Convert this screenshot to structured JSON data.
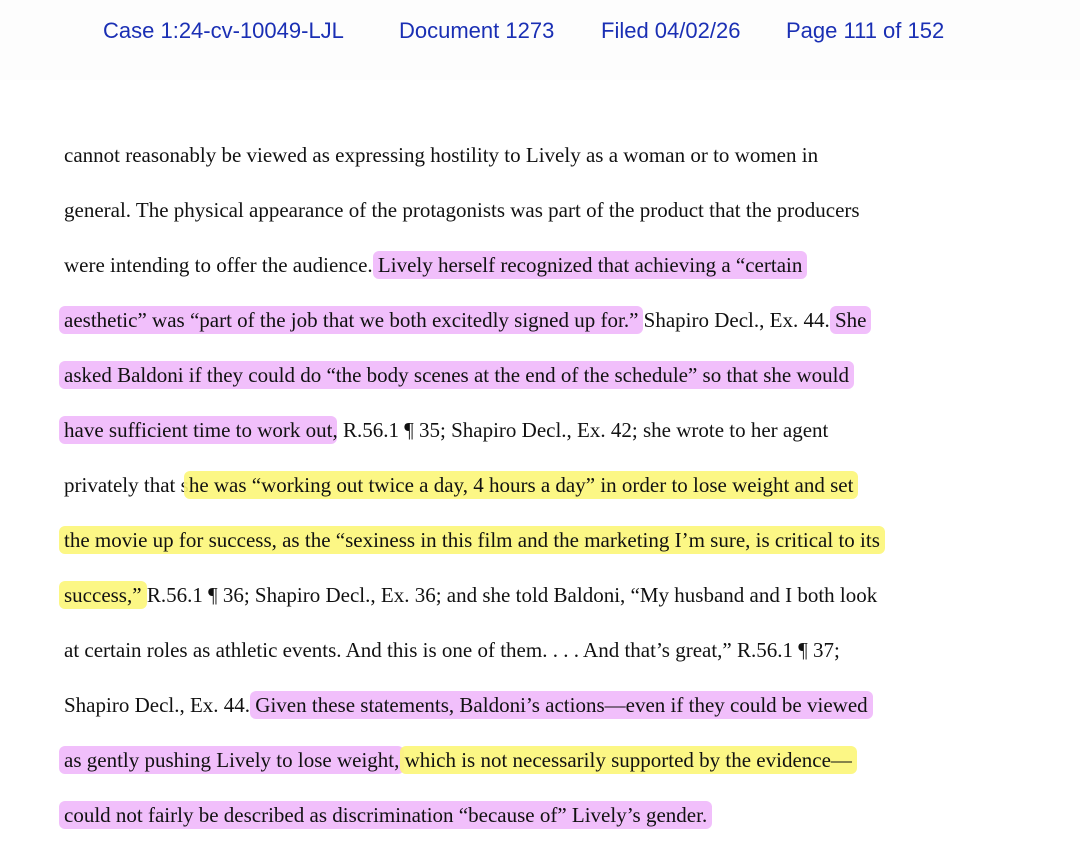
{
  "header": {
    "case": "Case 1:24-cv-10049-LJL",
    "document": "Document 1273",
    "filed": "Filed 04/02/26",
    "page": "Page 111 of 152"
  },
  "body": {
    "l1": "cannot reasonably be viewed as expressing hostility to Lively as a woman or to women in",
    "l2": "general.  The physical appearance of the protagonists was part of the product that the producers",
    "l3a": "were intending to offer the audience. ",
    "l3b": "Lively herself recognized that achieving a “certain",
    "l4a": "aesthetic” was “part of the job that we both excitedly signed up for.”",
    "l4b": "  Shapiro Decl., Ex. 44. ",
    "l4c": "She",
    "l5": "asked Baldoni if they could do “the body scenes at the end of the schedule” so that she would",
    "l6a": "have sufficient time to work out",
    "l6b": ", R.56.1 ¶ 35; Shapiro Decl., Ex. 42; she wrote to her agent",
    "l7a": "privately that s",
    "l7b": "he was “working out twice a day, 4 hours a day” in order to lose weight and set",
    "l8": "the movie up for success, as the “sexiness in this film and the marketing I’m sure, is critical to its",
    "l9a": "success,”",
    "l9b": " R.56.1 ¶ 36; Shapiro Decl., Ex. 36; and she told Baldoni, “My husband and I both look",
    "l10": "at certain roles as athletic events.  And this is one of them. . . .  And that’s great,” R.56.1 ¶ 37;",
    "l11a": "Shapiro Decl., Ex. 44. ",
    "l11b": "Given these statements, Baldoni’s actions—even if they could be viewed",
    "l12a": "as gently pushing Lively to lose weight,",
    "l12b": " ",
    "l12c": "which is not necessarily supported by the evidence—",
    "l13": "could not fairly be described as discrimination “because of” Lively’s gender."
  },
  "highlight_colors": {
    "pink": "#ecaafa",
    "yellow": "#fcf678"
  }
}
